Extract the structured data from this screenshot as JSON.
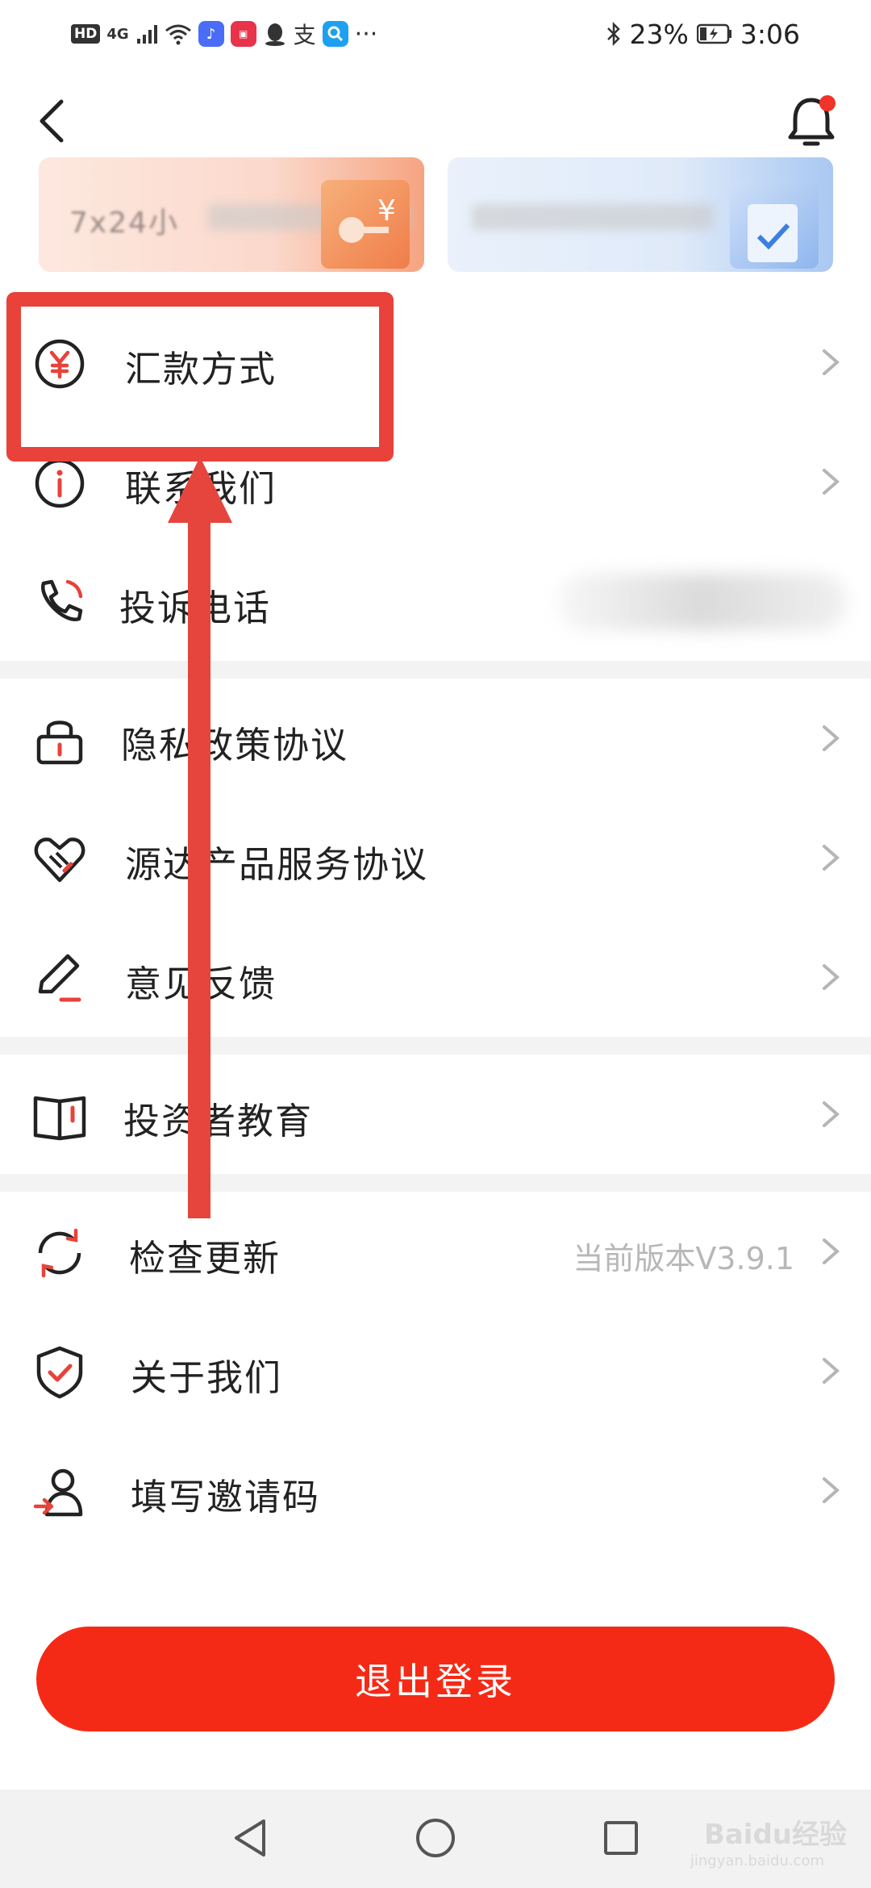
{
  "status_bar": {
    "left_badge": "HD",
    "network": "4G",
    "more": "···",
    "battery": "23%",
    "time": "3:06"
  },
  "promo_cards": [
    {
      "text": "7x24小"
    },
    {
      "text": ""
    }
  ],
  "menu": {
    "remit": {
      "label": "汇款方式"
    },
    "contact": {
      "label": "联系我们"
    },
    "complaint": {
      "label": "投诉电话"
    },
    "privacy": {
      "label": "隐私政策协议"
    },
    "service": {
      "label": "源达产品服务协议"
    },
    "feedback": {
      "label": "意见反馈"
    },
    "education": {
      "label": "投资者教育"
    },
    "update": {
      "label": "检查更新",
      "value": "当前版本V3.9.1"
    },
    "about": {
      "label": "关于我们"
    },
    "invite": {
      "label": "填写邀请码"
    }
  },
  "logout": {
    "label": "退出登录"
  },
  "watermark": {
    "brand": "Baidu经验",
    "url": "jingyan.baidu.com"
  },
  "colors": {
    "accent": "#f52a16",
    "annotation": "#e8423a"
  },
  "icons": {
    "remit": "yuan-circle-icon",
    "contact": "info-circle-icon",
    "complaint": "phone-icon",
    "privacy": "lock-icon",
    "service": "handshake-heart-icon",
    "feedback": "pen-icon",
    "education": "book-icon",
    "update": "refresh-icon",
    "about": "shield-check-icon",
    "invite": "user-share-icon"
  }
}
